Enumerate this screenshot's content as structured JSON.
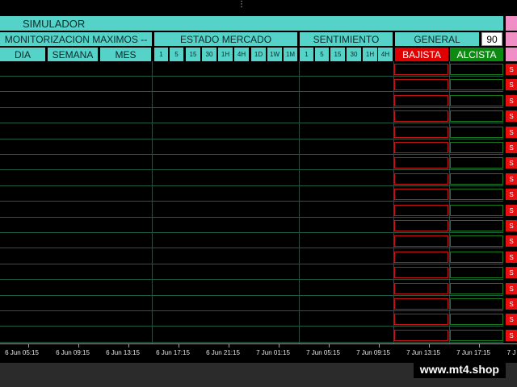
{
  "simulator": {
    "label": "SIMULADOR"
  },
  "headers": {
    "monitorizacion": "MONITORIZACION MAXIMOS --",
    "estado_mercado": "ESTADO MERCADO",
    "sentimiento": "SENTIMIENTO",
    "general": "GENERAL",
    "general_value": "90"
  },
  "monitor_tabs": [
    "DIA",
    "SEMANA",
    "MES"
  ],
  "estado_timeframes": [
    "1",
    "5",
    "15",
    "30",
    "1H",
    "4H",
    "1D",
    "1W",
    "1M"
  ],
  "sentimiento_timeframes": [
    "1",
    "5",
    "15",
    "30",
    "1H",
    "4H"
  ],
  "signals": {
    "bajista": "BAJISTA",
    "alcista": "ALCISTA",
    "s_label": "S",
    "bajista_color": "#e00000",
    "alcista_color": "#0d8a12"
  },
  "time_axis": [
    "6 Jun 05:15",
    "6 Jun 09:15",
    "6 Jun 13:15",
    "6 Jun 17:15",
    "6 Jun 21:15",
    "7 Jun 01:15",
    "7 Jun 05:15",
    "7 Jun 09:15",
    "7 Jun 13:15",
    "7 Jun 17:15",
    "7 J"
  ],
  "watermark": "www.mt4.shop"
}
